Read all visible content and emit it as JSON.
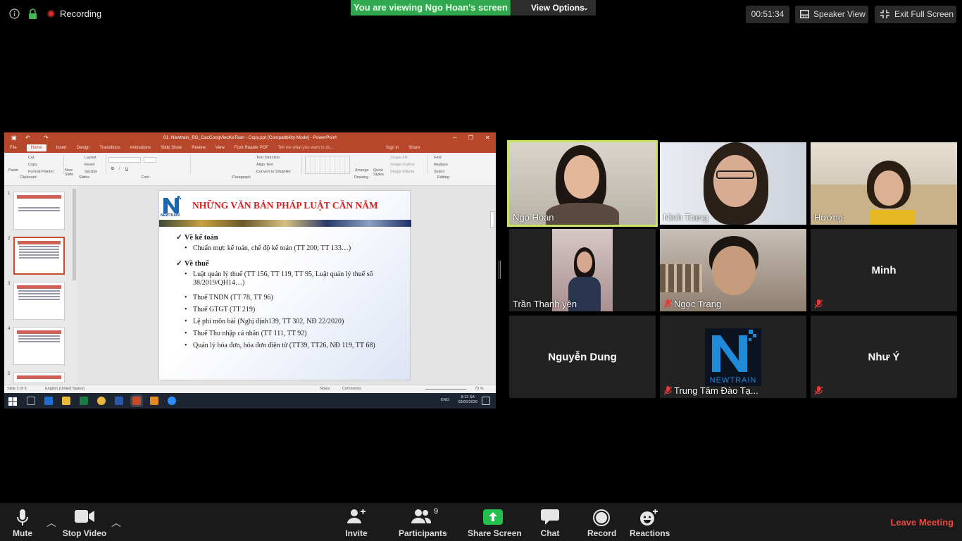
{
  "topbar": {
    "recording_label": "Recording",
    "viewing_banner": "You are viewing Ngo Hoan's screen",
    "view_options": "View Options",
    "timer": "00:51:34",
    "speaker_view": "Speaker View",
    "exit_full_screen": "Exit Full Screen"
  },
  "ppt": {
    "window_title": "01. Newtrain_BG_CacCongViecKeToan - Copy.ppt [Compatibility Mode] - PowerPoint",
    "tabs": [
      "File",
      "Home",
      "Insert",
      "Design",
      "Transitions",
      "Animations",
      "Slide Show",
      "Review",
      "View",
      "Foxit Reader PDF"
    ],
    "tell_me": "Tell me what you want to do...",
    "sign_in": "Sign in",
    "share": "Share",
    "groups": [
      "Clipboard",
      "Slides",
      "Font",
      "Paragraph",
      "Drawing",
      "Editing"
    ],
    "ribbon": {
      "paste": "Paste",
      "cut": "Cut",
      "copy": "Copy",
      "format_painter": "Format Painter",
      "new_slide": "New Slide",
      "layout": "Layout",
      "reset": "Reset",
      "section": "Section",
      "text_direction": "Text Direction",
      "align_text": "Align Text",
      "convert_smartart": "Convert to SmartArt",
      "arrange": "Arrange",
      "quick_styles": "Quick Styles",
      "shape_fill": "Shape Fill",
      "shape_outline": "Shape Outline",
      "shape_effects": "Shape Effects",
      "find": "Find",
      "replace": "Replace",
      "select": "Select"
    },
    "slide": {
      "title": "NHỮNG VĂN BẢN PHÁP LUẬT CẦN NẮM",
      "logo_text": "NEWTRAIN",
      "section1": "Về kế toán",
      "item1": "Chuẩn mực kế toán, chế độ kế toán (TT 200; TT 133…)",
      "section2": "Về thuế",
      "item2": "Luật quản lý thuế (TT 156, TT 119, TT 95, Luật quản lý thuế số 38/2019/QH14…)",
      "item3": "Thuế TNDN (TT 78, TT 96)",
      "item4": "Thuế GTGT (TT 219)",
      "item5": "Lệ phí môn bài (Nghị định139, TT 302, NĐ 22/2020)",
      "item6": "Thuế Thu nhập cá nhân (TT 111, TT 92)",
      "item7": "Quản lý hóa đơn, hóa đơn điện tử (TT39, TT26, NĐ 119, TT 68)"
    },
    "thumb_numbers": [
      "1",
      "2",
      "3",
      "4",
      "5"
    ],
    "status": {
      "slide_of": "Slide 2 of 9",
      "language": "English (United States)",
      "notes": "Notes",
      "comments": "Comments",
      "zoom": "73 %"
    },
    "taskbar": {
      "lang": "ENG",
      "time": "8:12 SA",
      "date": "03/05/2020"
    }
  },
  "participants": [
    {
      "name": "Ngo Hoan",
      "video": true,
      "muted": false,
      "active": true
    },
    {
      "name": "Ninh Trang",
      "video": true,
      "muted": false
    },
    {
      "name": "Hương",
      "video": true,
      "muted": false
    },
    {
      "name": "Trần Thanh yên",
      "video": true,
      "muted": false
    },
    {
      "name": "Ngọc Trang",
      "video": true,
      "muted": true
    },
    {
      "name": "Minh",
      "video": false,
      "muted": true
    },
    {
      "name": "Nguyễn Dung",
      "video": false,
      "muted": false
    },
    {
      "name": "Trung Tâm Đào Tạ...",
      "video": true,
      "muted": true,
      "logo_text": "NEWTRAIN"
    },
    {
      "name": "Như Ý",
      "video": false,
      "muted": true
    }
  ],
  "bottombar": {
    "mute": "Mute",
    "stop_video": "Stop Video",
    "invite": "Invite",
    "participants": "Participants",
    "participants_count": "9",
    "share_screen": "Share Screen",
    "chat": "Chat",
    "record": "Record",
    "reactions": "Reactions",
    "leave": "Leave Meeting"
  },
  "colors": {
    "banner_green": "#2fa84f",
    "ppt_accent": "#b7472a",
    "active_speaker": "#c9e265",
    "leave_red": "#e8483e",
    "share_green": "#23c04b"
  }
}
